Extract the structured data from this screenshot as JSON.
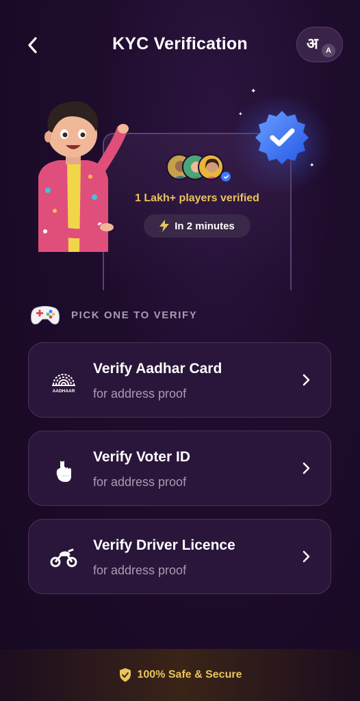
{
  "header": {
    "title": "KYC Verification",
    "back_icon": "chevron-left-icon",
    "language_toggle": {
      "hindi_glyph": "अ",
      "english_glyph": "A",
      "icon": "language-toggle-icon"
    }
  },
  "hero": {
    "players_text": "1 Lakh+ players verified",
    "time_text": "In 2 minutes",
    "badge_icon": "verified-badge-icon",
    "time_icon": "lightning-icon",
    "accent_color": "#e9c45c"
  },
  "section": {
    "label": "PICK ONE TO VERIFY",
    "icon": "gamepad-icon"
  },
  "options": [
    {
      "title": "Verify Aadhar Card",
      "subtitle": "for address proof",
      "icon": "aadhaar-logo-icon",
      "logo_text": "AADHAAR"
    },
    {
      "title": "Verify Voter ID",
      "subtitle": "for address proof",
      "icon": "ink-finger-icon"
    },
    {
      "title": "Verify Driver Licence",
      "subtitle": "for address proof",
      "icon": "motorbike-icon"
    }
  ],
  "footer": {
    "text": "100% Safe & Secure",
    "icon": "shield-check-icon"
  },
  "colors": {
    "background": "#1a0b26",
    "card_bg": "#2a163a",
    "card_border": "#4a3358",
    "gold": "#e9c45c",
    "muted": "#a89bb4",
    "badge_blue": "#3d7bff"
  }
}
